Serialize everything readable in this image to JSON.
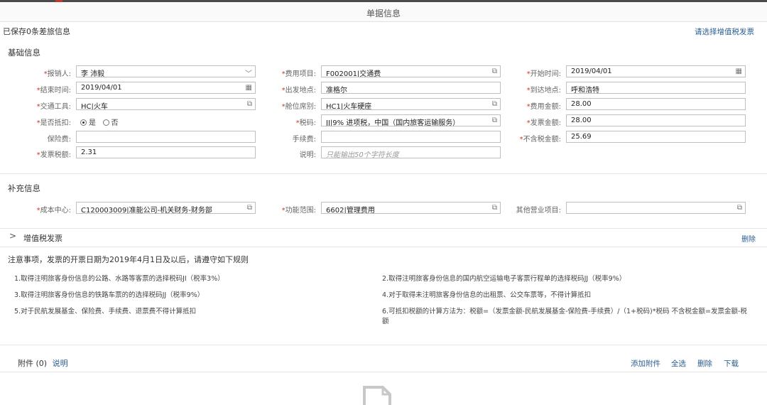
{
  "header": {
    "title": "单据信息"
  },
  "saved_info": "已保存0条差旅信息",
  "vat_select_link": "请选择增值税发票",
  "basic": {
    "title": "基础信息",
    "fields": {
      "claimant": {
        "label": "报销人:",
        "value": "李 沛毅",
        "icon": "chevron-down-icon"
      },
      "expense_item": {
        "label": "费用项目:",
        "value": "F002001|交通费",
        "icon": "popup-select-icon"
      },
      "start_time": {
        "label": "开始时间:",
        "value": "2019/04/01",
        "icon": "calendar-icon"
      },
      "end_time": {
        "label": "结束时间:",
        "value": "2019/04/01",
        "icon": "calendar-icon"
      },
      "departure": {
        "label": "出发地点:",
        "value": "准格尔"
      },
      "arrival": {
        "label": "到达地点:",
        "value": "呼和浩特"
      },
      "transport": {
        "label": "交通工具:",
        "value": "HC|火车",
        "icon": "popup-select-icon"
      },
      "seat_class": {
        "label": "舱位席别:",
        "value": "HC1|火车硬座",
        "icon": "popup-select-icon"
      },
      "expense_amount": {
        "label": "费用金额:",
        "value": "28.00"
      },
      "deductible": {
        "label": "是否抵扣:",
        "options": [
          "是",
          "否"
        ],
        "selected": "是"
      },
      "tax_code": {
        "label": "税码:",
        "value": "JJ|9% 进项税，中国（国内旅客运输服务）",
        "icon": "popup-select-icon"
      },
      "invoice_amount": {
        "label": "发票金额:",
        "value": "28.00"
      },
      "insurance": {
        "label": "保险费:",
        "value": ""
      },
      "handling_fee": {
        "label": "手续费:",
        "value": ""
      },
      "tax_excluded": {
        "label": "不含税金额:",
        "value": "25.69"
      },
      "invoice_tax": {
        "label": "发票税额:",
        "value": "2.31"
      },
      "note": {
        "label": "说明:",
        "placeholder": "只能输出50个字符长度"
      }
    }
  },
  "supplement": {
    "title": "补充信息",
    "fields": {
      "cost_center": {
        "label": "成本中心:",
        "value": "C120003009|准能公司-机关财务-财务部",
        "icon": "popup-select-icon"
      },
      "functional_area": {
        "label": "功能范围:",
        "value": "6602|管理费用",
        "icon": "popup-select-icon"
      },
      "other_project": {
        "label": "其他营业项目:",
        "value": "",
        "icon": "popup-select-icon"
      }
    }
  },
  "vat_invoice": {
    "label": "增值税发票",
    "delete_label": "删除",
    "chevron": "chevron-right-icon"
  },
  "notice": {
    "title": "注意事项，发票的开票日期为2019年4月1日及以后，请遵守如下规则",
    "rules": [
      "1.取得注明旅客身份信息的公路、水路等客票的选择税码JI（税率3%）",
      "2.取得注明旅客身份信息的国内航空运输电子客票行程单的选择税码JJ（税率9%）",
      "3.取得注明旅客身份信息的铁路车票的的选择税码JJ（税率9%）",
      "4.对于取得未注明旅客身份信息的出租票、公交车票等，不得计算抵扣",
      "5.对于民航发展基金、保险费、手续费、退票费不得计算抵扣",
      "6.可抵扣税额的计算方法为：税额=（发票金额-民航发展基金-保险费-手续费）/（1+税码)*税码 不含税金额=发票金额-税额"
    ]
  },
  "attachments": {
    "label": "附件 (0)",
    "explain": "说明",
    "actions": [
      "添加附件",
      "全选",
      "删除",
      "下载"
    ]
  },
  "colors": {
    "link": "#2a5d8f",
    "required": "#c0392b"
  }
}
